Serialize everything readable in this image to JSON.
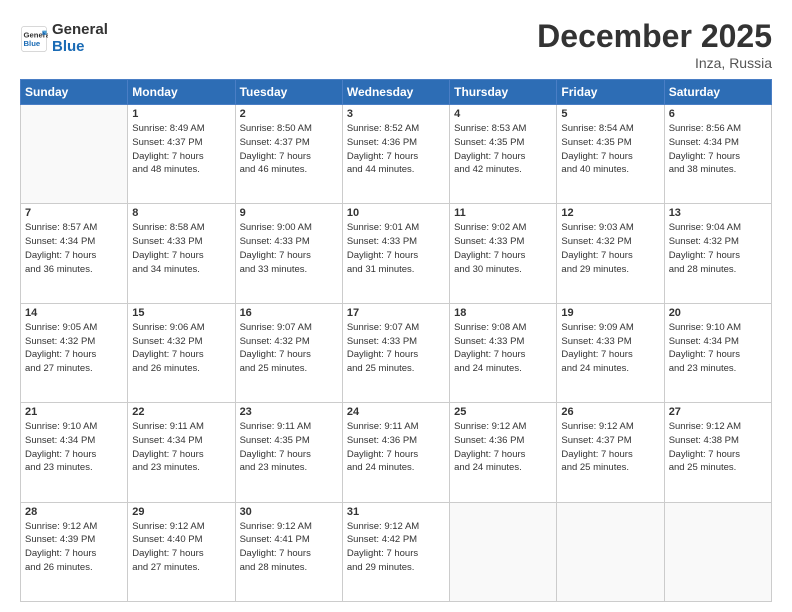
{
  "header": {
    "logo_line1": "General",
    "logo_line2": "Blue",
    "month": "December 2025",
    "location": "Inza, Russia"
  },
  "weekdays": [
    "Sunday",
    "Monday",
    "Tuesday",
    "Wednesday",
    "Thursday",
    "Friday",
    "Saturday"
  ],
  "weeks": [
    [
      {
        "day": "",
        "info": ""
      },
      {
        "day": "1",
        "info": "Sunrise: 8:49 AM\nSunset: 4:37 PM\nDaylight: 7 hours\nand 48 minutes."
      },
      {
        "day": "2",
        "info": "Sunrise: 8:50 AM\nSunset: 4:37 PM\nDaylight: 7 hours\nand 46 minutes."
      },
      {
        "day": "3",
        "info": "Sunrise: 8:52 AM\nSunset: 4:36 PM\nDaylight: 7 hours\nand 44 minutes."
      },
      {
        "day": "4",
        "info": "Sunrise: 8:53 AM\nSunset: 4:35 PM\nDaylight: 7 hours\nand 42 minutes."
      },
      {
        "day": "5",
        "info": "Sunrise: 8:54 AM\nSunset: 4:35 PM\nDaylight: 7 hours\nand 40 minutes."
      },
      {
        "day": "6",
        "info": "Sunrise: 8:56 AM\nSunset: 4:34 PM\nDaylight: 7 hours\nand 38 minutes."
      }
    ],
    [
      {
        "day": "7",
        "info": "Sunrise: 8:57 AM\nSunset: 4:34 PM\nDaylight: 7 hours\nand 36 minutes."
      },
      {
        "day": "8",
        "info": "Sunrise: 8:58 AM\nSunset: 4:33 PM\nDaylight: 7 hours\nand 34 minutes."
      },
      {
        "day": "9",
        "info": "Sunrise: 9:00 AM\nSunset: 4:33 PM\nDaylight: 7 hours\nand 33 minutes."
      },
      {
        "day": "10",
        "info": "Sunrise: 9:01 AM\nSunset: 4:33 PM\nDaylight: 7 hours\nand 31 minutes."
      },
      {
        "day": "11",
        "info": "Sunrise: 9:02 AM\nSunset: 4:33 PM\nDaylight: 7 hours\nand 30 minutes."
      },
      {
        "day": "12",
        "info": "Sunrise: 9:03 AM\nSunset: 4:32 PM\nDaylight: 7 hours\nand 29 minutes."
      },
      {
        "day": "13",
        "info": "Sunrise: 9:04 AM\nSunset: 4:32 PM\nDaylight: 7 hours\nand 28 minutes."
      }
    ],
    [
      {
        "day": "14",
        "info": "Sunrise: 9:05 AM\nSunset: 4:32 PM\nDaylight: 7 hours\nand 27 minutes."
      },
      {
        "day": "15",
        "info": "Sunrise: 9:06 AM\nSunset: 4:32 PM\nDaylight: 7 hours\nand 26 minutes."
      },
      {
        "day": "16",
        "info": "Sunrise: 9:07 AM\nSunset: 4:32 PM\nDaylight: 7 hours\nand 25 minutes."
      },
      {
        "day": "17",
        "info": "Sunrise: 9:07 AM\nSunset: 4:33 PM\nDaylight: 7 hours\nand 25 minutes."
      },
      {
        "day": "18",
        "info": "Sunrise: 9:08 AM\nSunset: 4:33 PM\nDaylight: 7 hours\nand 24 minutes."
      },
      {
        "day": "19",
        "info": "Sunrise: 9:09 AM\nSunset: 4:33 PM\nDaylight: 7 hours\nand 24 minutes."
      },
      {
        "day": "20",
        "info": "Sunrise: 9:10 AM\nSunset: 4:34 PM\nDaylight: 7 hours\nand 23 minutes."
      }
    ],
    [
      {
        "day": "21",
        "info": "Sunrise: 9:10 AM\nSunset: 4:34 PM\nDaylight: 7 hours\nand 23 minutes."
      },
      {
        "day": "22",
        "info": "Sunrise: 9:11 AM\nSunset: 4:34 PM\nDaylight: 7 hours\nand 23 minutes."
      },
      {
        "day": "23",
        "info": "Sunrise: 9:11 AM\nSunset: 4:35 PM\nDaylight: 7 hours\nand 23 minutes."
      },
      {
        "day": "24",
        "info": "Sunrise: 9:11 AM\nSunset: 4:36 PM\nDaylight: 7 hours\nand 24 minutes."
      },
      {
        "day": "25",
        "info": "Sunrise: 9:12 AM\nSunset: 4:36 PM\nDaylight: 7 hours\nand 24 minutes."
      },
      {
        "day": "26",
        "info": "Sunrise: 9:12 AM\nSunset: 4:37 PM\nDaylight: 7 hours\nand 25 minutes."
      },
      {
        "day": "27",
        "info": "Sunrise: 9:12 AM\nSunset: 4:38 PM\nDaylight: 7 hours\nand 25 minutes."
      }
    ],
    [
      {
        "day": "28",
        "info": "Sunrise: 9:12 AM\nSunset: 4:39 PM\nDaylight: 7 hours\nand 26 minutes."
      },
      {
        "day": "29",
        "info": "Sunrise: 9:12 AM\nSunset: 4:40 PM\nDaylight: 7 hours\nand 27 minutes."
      },
      {
        "day": "30",
        "info": "Sunrise: 9:12 AM\nSunset: 4:41 PM\nDaylight: 7 hours\nand 28 minutes."
      },
      {
        "day": "31",
        "info": "Sunrise: 9:12 AM\nSunset: 4:42 PM\nDaylight: 7 hours\nand 29 minutes."
      },
      {
        "day": "",
        "info": ""
      },
      {
        "day": "",
        "info": ""
      },
      {
        "day": "",
        "info": ""
      }
    ]
  ]
}
